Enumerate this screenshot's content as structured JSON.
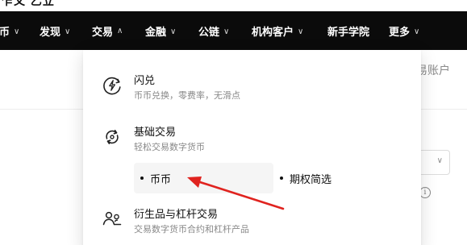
{
  "top_strip": {
    "cut_text": "乍乂 乙立"
  },
  "nav": {
    "items": [
      {
        "label": "币",
        "open": false
      },
      {
        "label": "发现",
        "open": false
      },
      {
        "label": "交易",
        "open": true
      },
      {
        "label": "金融",
        "open": false
      },
      {
        "label": "公链",
        "open": false
      },
      {
        "label": "机构客户",
        "open": false
      },
      {
        "label": "新手学院",
        "open": false
      },
      {
        "label": "更多",
        "open": false
      }
    ]
  },
  "background": {
    "right_text": "易账户"
  },
  "dropdown": {
    "items": [
      {
        "title": "闪兑",
        "desc": "币币兑换，零费率，无滑点",
        "icon": "flash-swap-icon"
      },
      {
        "title": "基础交易",
        "desc": "轻松交易数字货币",
        "icon": "refresh-icon"
      },
      {
        "title": "衍生品与杠杆交易",
        "desc": "交易数字货币合约和杠杆产品",
        "icon": "users-icon"
      }
    ],
    "sub_items": [
      {
        "label": "币币",
        "hovered": true
      },
      {
        "label": "期权简选",
        "hovered": false
      }
    ]
  },
  "annotation": {
    "arrow_color": "#e0231f"
  }
}
